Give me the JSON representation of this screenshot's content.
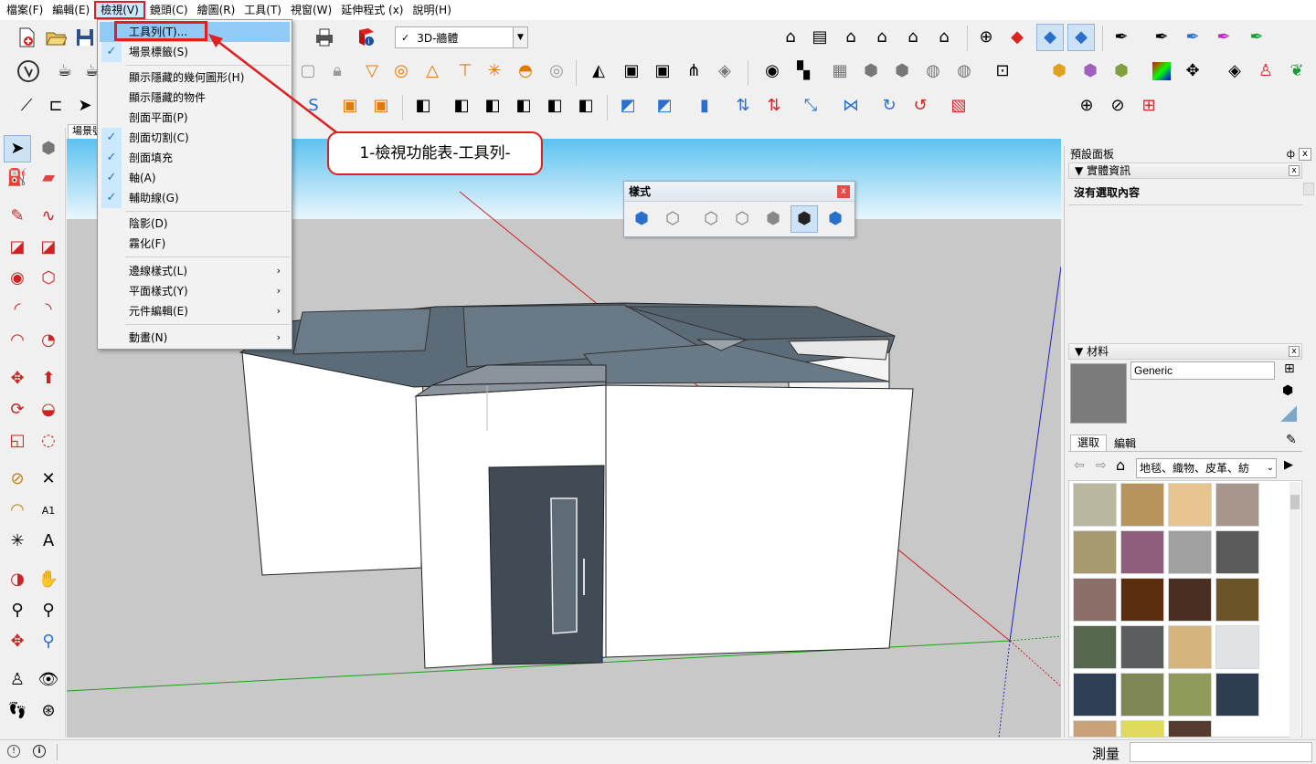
{
  "menubar": [
    "檔案(F)",
    "編輯(E)",
    "檢視(V)",
    "鏡頭(C)",
    "繪圖(R)",
    "工具(T)",
    "視窗(W)",
    "延伸程式 (x)",
    "說明(H)"
  ],
  "scene_select": {
    "value": "3D-牆體"
  },
  "scene_tab": "場景號",
  "view_menu": {
    "items": [
      {
        "label": "工具列(T)...",
        "checked": false,
        "submenu": false
      },
      {
        "label": "場景標籤(S)",
        "checked": true,
        "submenu": false
      },
      {
        "label": "顯示隱藏的幾何圖形(H)",
        "checked": false,
        "submenu": false
      },
      {
        "label": "顯示隱藏的物件",
        "checked": false,
        "submenu": false
      },
      {
        "label": "剖面平面(P)",
        "checked": false,
        "submenu": false
      },
      {
        "label": "剖面切割(C)",
        "checked": true,
        "submenu": false
      },
      {
        "label": "剖面填充",
        "checked": true,
        "submenu": false
      },
      {
        "label": "軸(A)",
        "checked": true,
        "submenu": false
      },
      {
        "label": "輔助線(G)",
        "checked": true,
        "submenu": false
      },
      {
        "label": "陰影(D)",
        "checked": false,
        "submenu": false
      },
      {
        "label": "霧化(F)",
        "checked": false,
        "submenu": false
      },
      {
        "label": "邊線樣式(L)",
        "checked": false,
        "submenu": true
      },
      {
        "label": "平面樣式(Y)",
        "checked": false,
        "submenu": true
      },
      {
        "label": "元件編輯(E)",
        "checked": false,
        "submenu": true
      },
      {
        "label": "動畫(N)",
        "checked": false,
        "submenu": true
      }
    ],
    "check_glyph": "✓",
    "submenu_glyph": "›"
  },
  "callout": "1-檢視功能表-工具列-",
  "style_palette": {
    "title": "樣式",
    "close": "x"
  },
  "tray": {
    "title": "預設面板",
    "pin": "ф",
    "close": "x",
    "entity_info": {
      "header": "實體資訊",
      "collapse": "▼",
      "text": "沒有選取內容"
    },
    "materials": {
      "header": "材料",
      "name_value": "Generic",
      "tabs": [
        "選取",
        "編輯"
      ],
      "category": "地毯、織物、皮革、紡",
      "swatch_colors": [
        "#b9b89e",
        "#b7955a",
        "#e7c38f",
        "#a8958b",
        "#a69a6e",
        "#8e5e7c",
        "#a0a0a0",
        "#5a5a5a",
        "#8b6e67",
        "#5c2e10",
        "#4a2e22",
        "#6b5528",
        "#55684f",
        "#5b5d5f",
        "#d6b47e",
        "#dfe3e6",
        "#2e3f55",
        "#7f8755",
        "#8f9b5a",
        "#2f3d50",
        "#c9a27a",
        "#e0da5a",
        "#553a30"
      ]
    }
  },
  "status": {
    "measure": "測量"
  },
  "colors": {
    "sky_top": "#5bc2f0",
    "sky_bottom": "#eaf6fc",
    "ground": "#c8c8c8",
    "accent_red": "#e02020",
    "roof": "#5c6b78",
    "door": "#404b55"
  }
}
